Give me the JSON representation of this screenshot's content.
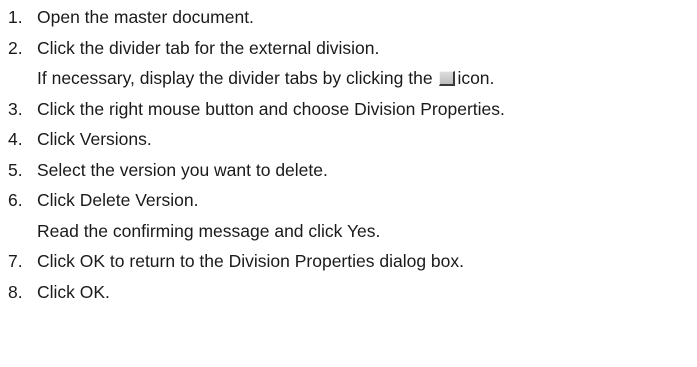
{
  "steps": [
    {
      "number": "1.",
      "text": "Open the master document."
    },
    {
      "number": "2.",
      "text": "Click the divider tab for the external division."
    },
    {
      "note_before": "If necessary, display the divider tabs by clicking the",
      "icon": "divider-tabs-icon",
      "note_after": "icon."
    },
    {
      "number": "3.",
      "text": "Click the right mouse button and choose Division Properties."
    },
    {
      "number": "4.",
      "text": "Click Versions."
    },
    {
      "number": "5.",
      "text": "Select the version you want to delete."
    },
    {
      "number": "6.",
      "text": "Click Delete Version."
    },
    {
      "note": "Read the confirming message and click Yes."
    },
    {
      "number": "7.",
      "text": "Click OK to return to the Division Properties dialog box."
    },
    {
      "number": "8.",
      "text": "Click OK."
    }
  ]
}
